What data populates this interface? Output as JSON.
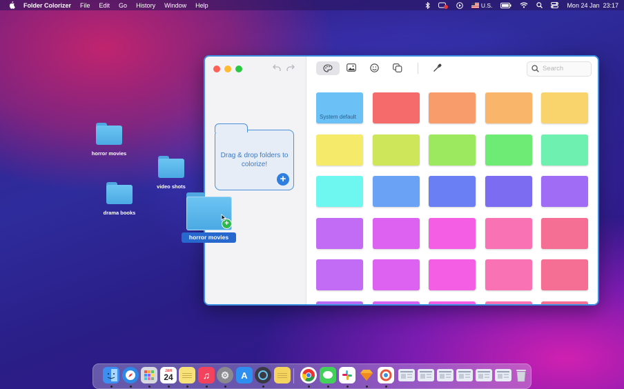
{
  "menubar": {
    "apple_icon": "apple-icon",
    "app_name": "Folder Colorizer",
    "menus": [
      "File",
      "Edit",
      "Go",
      "History",
      "Window",
      "Help"
    ],
    "status": {
      "input_source": "U.S.",
      "datetime": "Mon 24 Jan  23:17"
    }
  },
  "desktop": {
    "icons": [
      {
        "label": "horror movies"
      },
      {
        "label": "video shots"
      },
      {
        "label": "drama books"
      }
    ],
    "drag_ghost": {
      "label": "horror movies"
    }
  },
  "window": {
    "dropzone": {
      "text": "Drag & drop folders to colorize!"
    },
    "search": {
      "placeholder": "Search"
    },
    "toolbar": [
      "palette-icon",
      "image-icon",
      "emoji-icon",
      "shapes-icon",
      "eyedropper-icon"
    ],
    "swatches": [
      {
        "color": "#6bc1f5",
        "label": "System default"
      },
      {
        "color": "#f56a6a"
      },
      {
        "color": "#f99c6b"
      },
      {
        "color": "#f9b66b"
      },
      {
        "color": "#f9d36b"
      },
      {
        "color": "#f6ea6b"
      },
      {
        "color": "#cde65a"
      },
      {
        "color": "#9ce95f"
      },
      {
        "color": "#6deb75"
      },
      {
        "color": "#6ef0b0"
      },
      {
        "color": "#6ef7f0"
      },
      {
        "color": "#6aa2f5"
      },
      {
        "color": "#6b7ff5"
      },
      {
        "color": "#7b6cf2"
      },
      {
        "color": "#a06cf5"
      },
      {
        "color": "#c26cf5"
      },
      {
        "color": "#dd62f2"
      },
      {
        "color": "#f45ee4"
      },
      {
        "color": "#f872b4"
      },
      {
        "color": "#f56f94"
      },
      {
        "color": "#c26cf5"
      },
      {
        "color": "#dd62f2"
      },
      {
        "color": "#f45ee4"
      },
      {
        "color": "#f872b4"
      },
      {
        "color": "#f56f94"
      },
      {
        "color": "#b86cf5"
      },
      {
        "color": "#d662f2"
      },
      {
        "color": "#f45ee4"
      },
      {
        "color": "#f872b4"
      },
      {
        "color": "#f56f94"
      }
    ]
  },
  "dock": {
    "calendar": {
      "month": "JAN",
      "day": "24"
    },
    "apps": [
      {
        "name": "finder-icon",
        "color": "#3c8ef0"
      },
      {
        "name": "safari-icon",
        "color": "#2f88e8"
      },
      {
        "name": "launchpad-icon",
        "color": "#d8d8e0"
      },
      {
        "name": "calendar-icon",
        "color": "#ffffff"
      },
      {
        "name": "notes-icon",
        "color": "#f7e27a"
      },
      {
        "name": "music-icon",
        "color": "#f3425e"
      },
      {
        "name": "system-preferences-icon",
        "color": "#8a8a90"
      },
      {
        "name": "app-store-icon",
        "color": "#2f8ff0"
      },
      {
        "name": "quicktime-icon",
        "color": "#3a3a44"
      },
      {
        "name": "stickies-icon",
        "color": "#f4d35e"
      },
      {
        "name": "chrome-icon",
        "color": "#ffffff"
      },
      {
        "name": "messages-icon",
        "color": "#43d15c"
      },
      {
        "name": "slack-icon",
        "color": "#ffffff"
      },
      {
        "name": "sketch-icon",
        "color": "#f6b23a"
      },
      {
        "name": "folder-colorizer-icon",
        "color": "#ffffff"
      },
      {
        "name": "recent-window-1",
        "color": "#e8ecf4"
      },
      {
        "name": "recent-window-2",
        "color": "#e8ecf4"
      },
      {
        "name": "recent-window-3",
        "color": "#e8ecf4"
      },
      {
        "name": "recent-window-4",
        "color": "#e8ecf4"
      },
      {
        "name": "recent-window-5",
        "color": "#e8ecf4"
      },
      {
        "name": "recent-window-6",
        "color": "#e8ecf4"
      },
      {
        "name": "trash-icon",
        "color": "#c9ccd6"
      }
    ]
  }
}
